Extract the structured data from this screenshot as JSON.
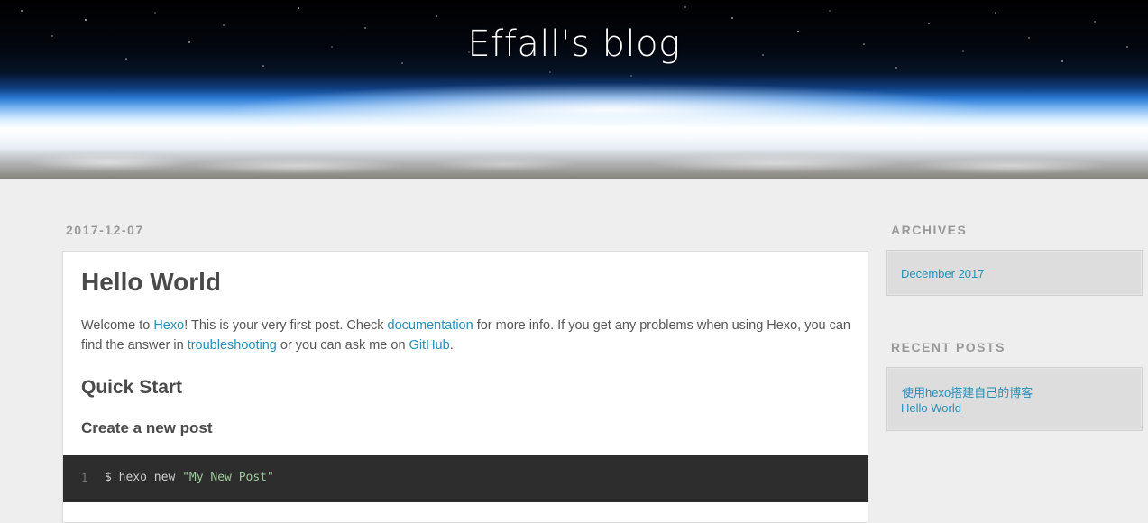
{
  "header": {
    "site_title": "Effall's blog"
  },
  "post": {
    "date": "2017-12-07",
    "title": "Hello World",
    "intro": {
      "t1": "Welcome to ",
      "link_hexo": "Hexo",
      "t2": "! This is your very first post. Check ",
      "link_documentation": "documentation",
      "t3": " for more info. If you get any problems when using Hexo, you can find the answer in ",
      "link_troubleshooting": "troubleshooting",
      "t4": " or you can ask me on ",
      "link_github": "GitHub",
      "t5": "."
    },
    "section_quick_start": "Quick Start",
    "section_create_post": "Create a new post",
    "code": {
      "line_number": "1",
      "command": "$ hexo new ",
      "argument": "\"My New Post\""
    }
  },
  "sidebar": {
    "archives": {
      "title": "ARCHIVES",
      "items": [
        "December 2017"
      ]
    },
    "recent_posts": {
      "title": "RECENT POSTS",
      "items": [
        "使用hexo搭建自己的博客",
        "Hello World"
      ]
    }
  },
  "colors": {
    "page_background": "#eeeeee",
    "link": "#258fb8",
    "code_background": "#2d2d2d",
    "code_string": "#99cc99",
    "heading": "#4a4a4a",
    "muted_label": "#999999"
  }
}
